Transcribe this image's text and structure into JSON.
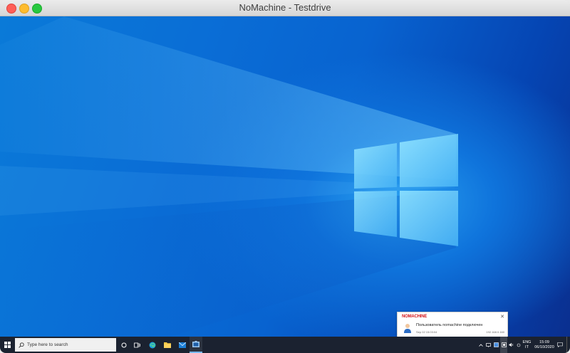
{
  "window": {
    "title": "NoMachine - Testdrive"
  },
  "taskbar": {
    "search_placeholder": "Type here to search",
    "language_line1": "ENG",
    "language_line2": "IT",
    "time": "15:09",
    "date": "06/10/2020"
  },
  "notification": {
    "brand": "NOMACHINE",
    "message": "Пользователь nomachine подключен",
    "time": "Sep 02 15:03:04",
    "ip": "192.168.0.160"
  }
}
